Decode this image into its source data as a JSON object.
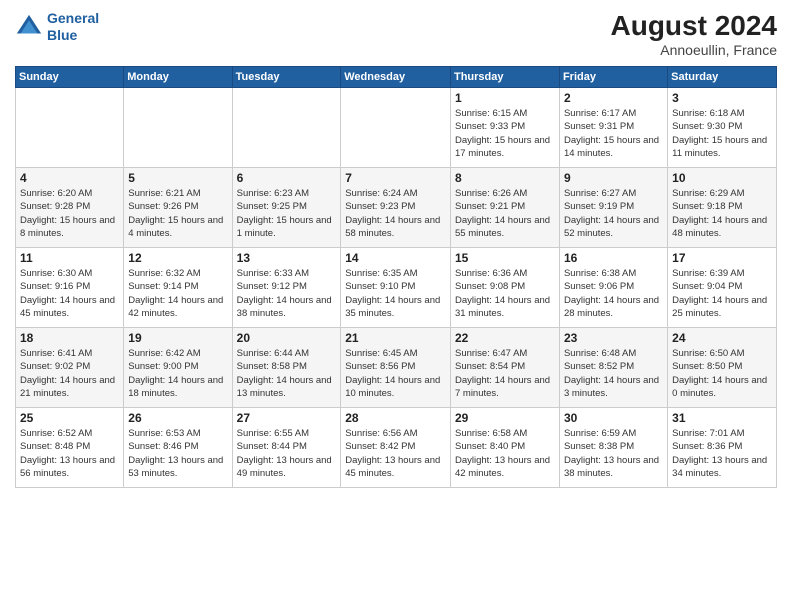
{
  "header": {
    "logo_line1": "General",
    "logo_line2": "Blue",
    "month_year": "August 2024",
    "location": "Annoeullin, France"
  },
  "days_of_week": [
    "Sunday",
    "Monday",
    "Tuesday",
    "Wednesday",
    "Thursday",
    "Friday",
    "Saturday"
  ],
  "weeks": [
    [
      {
        "day": "",
        "info": ""
      },
      {
        "day": "",
        "info": ""
      },
      {
        "day": "",
        "info": ""
      },
      {
        "day": "",
        "info": ""
      },
      {
        "day": "1",
        "info": "Sunrise: 6:15 AM\nSunset: 9:33 PM\nDaylight: 15 hours and 17 minutes."
      },
      {
        "day": "2",
        "info": "Sunrise: 6:17 AM\nSunset: 9:31 PM\nDaylight: 15 hours and 14 minutes."
      },
      {
        "day": "3",
        "info": "Sunrise: 6:18 AM\nSunset: 9:30 PM\nDaylight: 15 hours and 11 minutes."
      }
    ],
    [
      {
        "day": "4",
        "info": "Sunrise: 6:20 AM\nSunset: 9:28 PM\nDaylight: 15 hours and 8 minutes."
      },
      {
        "day": "5",
        "info": "Sunrise: 6:21 AM\nSunset: 9:26 PM\nDaylight: 15 hours and 4 minutes."
      },
      {
        "day": "6",
        "info": "Sunrise: 6:23 AM\nSunset: 9:25 PM\nDaylight: 15 hours and 1 minute."
      },
      {
        "day": "7",
        "info": "Sunrise: 6:24 AM\nSunset: 9:23 PM\nDaylight: 14 hours and 58 minutes."
      },
      {
        "day": "8",
        "info": "Sunrise: 6:26 AM\nSunset: 9:21 PM\nDaylight: 14 hours and 55 minutes."
      },
      {
        "day": "9",
        "info": "Sunrise: 6:27 AM\nSunset: 9:19 PM\nDaylight: 14 hours and 52 minutes."
      },
      {
        "day": "10",
        "info": "Sunrise: 6:29 AM\nSunset: 9:18 PM\nDaylight: 14 hours and 48 minutes."
      }
    ],
    [
      {
        "day": "11",
        "info": "Sunrise: 6:30 AM\nSunset: 9:16 PM\nDaylight: 14 hours and 45 minutes."
      },
      {
        "day": "12",
        "info": "Sunrise: 6:32 AM\nSunset: 9:14 PM\nDaylight: 14 hours and 42 minutes."
      },
      {
        "day": "13",
        "info": "Sunrise: 6:33 AM\nSunset: 9:12 PM\nDaylight: 14 hours and 38 minutes."
      },
      {
        "day": "14",
        "info": "Sunrise: 6:35 AM\nSunset: 9:10 PM\nDaylight: 14 hours and 35 minutes."
      },
      {
        "day": "15",
        "info": "Sunrise: 6:36 AM\nSunset: 9:08 PM\nDaylight: 14 hours and 31 minutes."
      },
      {
        "day": "16",
        "info": "Sunrise: 6:38 AM\nSunset: 9:06 PM\nDaylight: 14 hours and 28 minutes."
      },
      {
        "day": "17",
        "info": "Sunrise: 6:39 AM\nSunset: 9:04 PM\nDaylight: 14 hours and 25 minutes."
      }
    ],
    [
      {
        "day": "18",
        "info": "Sunrise: 6:41 AM\nSunset: 9:02 PM\nDaylight: 14 hours and 21 minutes."
      },
      {
        "day": "19",
        "info": "Sunrise: 6:42 AM\nSunset: 9:00 PM\nDaylight: 14 hours and 18 minutes."
      },
      {
        "day": "20",
        "info": "Sunrise: 6:44 AM\nSunset: 8:58 PM\nDaylight: 14 hours and 13 minutes."
      },
      {
        "day": "21",
        "info": "Sunrise: 6:45 AM\nSunset: 8:56 PM\nDaylight: 14 hours and 10 minutes."
      },
      {
        "day": "22",
        "info": "Sunrise: 6:47 AM\nSunset: 8:54 PM\nDaylight: 14 hours and 7 minutes."
      },
      {
        "day": "23",
        "info": "Sunrise: 6:48 AM\nSunset: 8:52 PM\nDaylight: 14 hours and 3 minutes."
      },
      {
        "day": "24",
        "info": "Sunrise: 6:50 AM\nSunset: 8:50 PM\nDaylight: 14 hours and 0 minutes."
      }
    ],
    [
      {
        "day": "25",
        "info": "Sunrise: 6:52 AM\nSunset: 8:48 PM\nDaylight: 13 hours and 56 minutes."
      },
      {
        "day": "26",
        "info": "Sunrise: 6:53 AM\nSunset: 8:46 PM\nDaylight: 13 hours and 53 minutes."
      },
      {
        "day": "27",
        "info": "Sunrise: 6:55 AM\nSunset: 8:44 PM\nDaylight: 13 hours and 49 minutes."
      },
      {
        "day": "28",
        "info": "Sunrise: 6:56 AM\nSunset: 8:42 PM\nDaylight: 13 hours and 45 minutes."
      },
      {
        "day": "29",
        "info": "Sunrise: 6:58 AM\nSunset: 8:40 PM\nDaylight: 13 hours and 42 minutes."
      },
      {
        "day": "30",
        "info": "Sunrise: 6:59 AM\nSunset: 8:38 PM\nDaylight: 13 hours and 38 minutes."
      },
      {
        "day": "31",
        "info": "Sunrise: 7:01 AM\nSunset: 8:36 PM\nDaylight: 13 hours and 34 minutes."
      }
    ]
  ]
}
